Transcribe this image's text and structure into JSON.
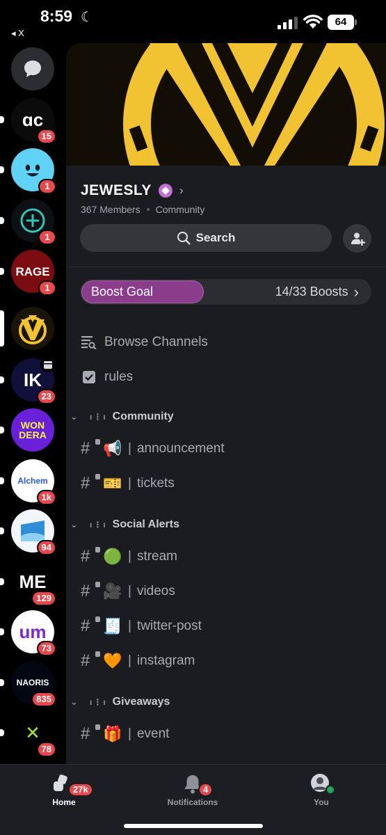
{
  "status_bar": {
    "time": "8:59",
    "back_label": "◂ X",
    "battery": "64"
  },
  "rail": {
    "dm_icon": "chat-bubble-icon",
    "servers": [
      {
        "name": "AC",
        "label": "ɑc",
        "badge": "15",
        "bg": "#0b0b0b",
        "fg": "#ffffff"
      },
      {
        "name": "Smile",
        "label": "",
        "badge": "1",
        "bg": "#5fd2f5",
        "fg": "#ffffff"
      },
      {
        "name": "Plus",
        "label": "+",
        "badge": "1",
        "bg": "#0c1014",
        "fg": "#30c6b7"
      },
      {
        "name": "Rage",
        "label": "RAGE",
        "badge": "1",
        "bg": "#7a0c12",
        "fg": "#ffffff"
      },
      {
        "name": "Jewesly",
        "label": "W",
        "badge": "",
        "bg": "#1a1407",
        "fg": "#f1c232"
      },
      {
        "name": "IK",
        "label": "IK",
        "badge": "23",
        "bg": "#11103a",
        "fg": "#ffffff"
      },
      {
        "name": "Wondera",
        "label": "WON DERA",
        "badge": "",
        "bg": "#6a1fd8",
        "fg": "#f6f542"
      },
      {
        "name": "Alchemy",
        "label": "Alchem",
        "badge": "1k",
        "bg": "#ffffff",
        "fg": "#2b58d4"
      },
      {
        "name": "Wave",
        "label": "",
        "badge": "94",
        "bg": "#f2f6fb",
        "fg": "#2e8fd8"
      },
      {
        "name": "ME",
        "label": "ME",
        "badge": "129",
        "bg": "#000000",
        "fg": "#ffffff"
      },
      {
        "name": "UM",
        "label": "um",
        "badge": "73",
        "bg": "#ffffff",
        "fg": "#7b2bd6"
      },
      {
        "name": "Naoris",
        "label": "NAORIS",
        "badge": "835",
        "bg": "#030712",
        "fg": "#ffffff"
      },
      {
        "name": "X",
        "label": "✕",
        "badge": "78",
        "bg": "#000000",
        "fg": "#9be63d"
      }
    ]
  },
  "server": {
    "name": "JEWESLY",
    "members": "367 Members",
    "type": "Community",
    "search_label": "Search",
    "boost_label": "Boost Goal",
    "boost_count": "14/33 Boosts",
    "boost_current": 14,
    "boost_goal": 33
  },
  "nav_rows": [
    {
      "icon": "browse-channels-icon",
      "label": "Browse Channels"
    },
    {
      "icon": "rules-icon",
      "label": "rules"
    }
  ],
  "categories": [
    {
      "name": "Community",
      "channels": [
        {
          "emoji": "📢",
          "name": "announcement"
        },
        {
          "emoji": "🎫",
          "name": "tickets"
        }
      ]
    },
    {
      "name": "Social Alerts",
      "channels": [
        {
          "emoji": "🟢",
          "name": "stream"
        },
        {
          "emoji": "🎥",
          "name": "videos"
        },
        {
          "emoji": "🧾",
          "name": "twitter-post"
        },
        {
          "emoji": "🧡",
          "name": "instagram"
        }
      ]
    },
    {
      "name": "Giveaways",
      "channels": [
        {
          "emoji": "🎁",
          "name": "event"
        }
      ]
    }
  ],
  "tabs": [
    {
      "label": "Home",
      "badge": "27k",
      "icon": "home-servers-icon",
      "active": true
    },
    {
      "label": "Notifications",
      "badge": "4",
      "icon": "bell-icon",
      "active": false
    },
    {
      "label": "You",
      "badge": "",
      "icon": "profile-avatar-icon",
      "active": false
    }
  ],
  "colors": {
    "accent_boost": "#8a3d8a",
    "badge_red": "#e5484d",
    "banner_gold": "#f1c232",
    "online_green": "#23a55a"
  }
}
